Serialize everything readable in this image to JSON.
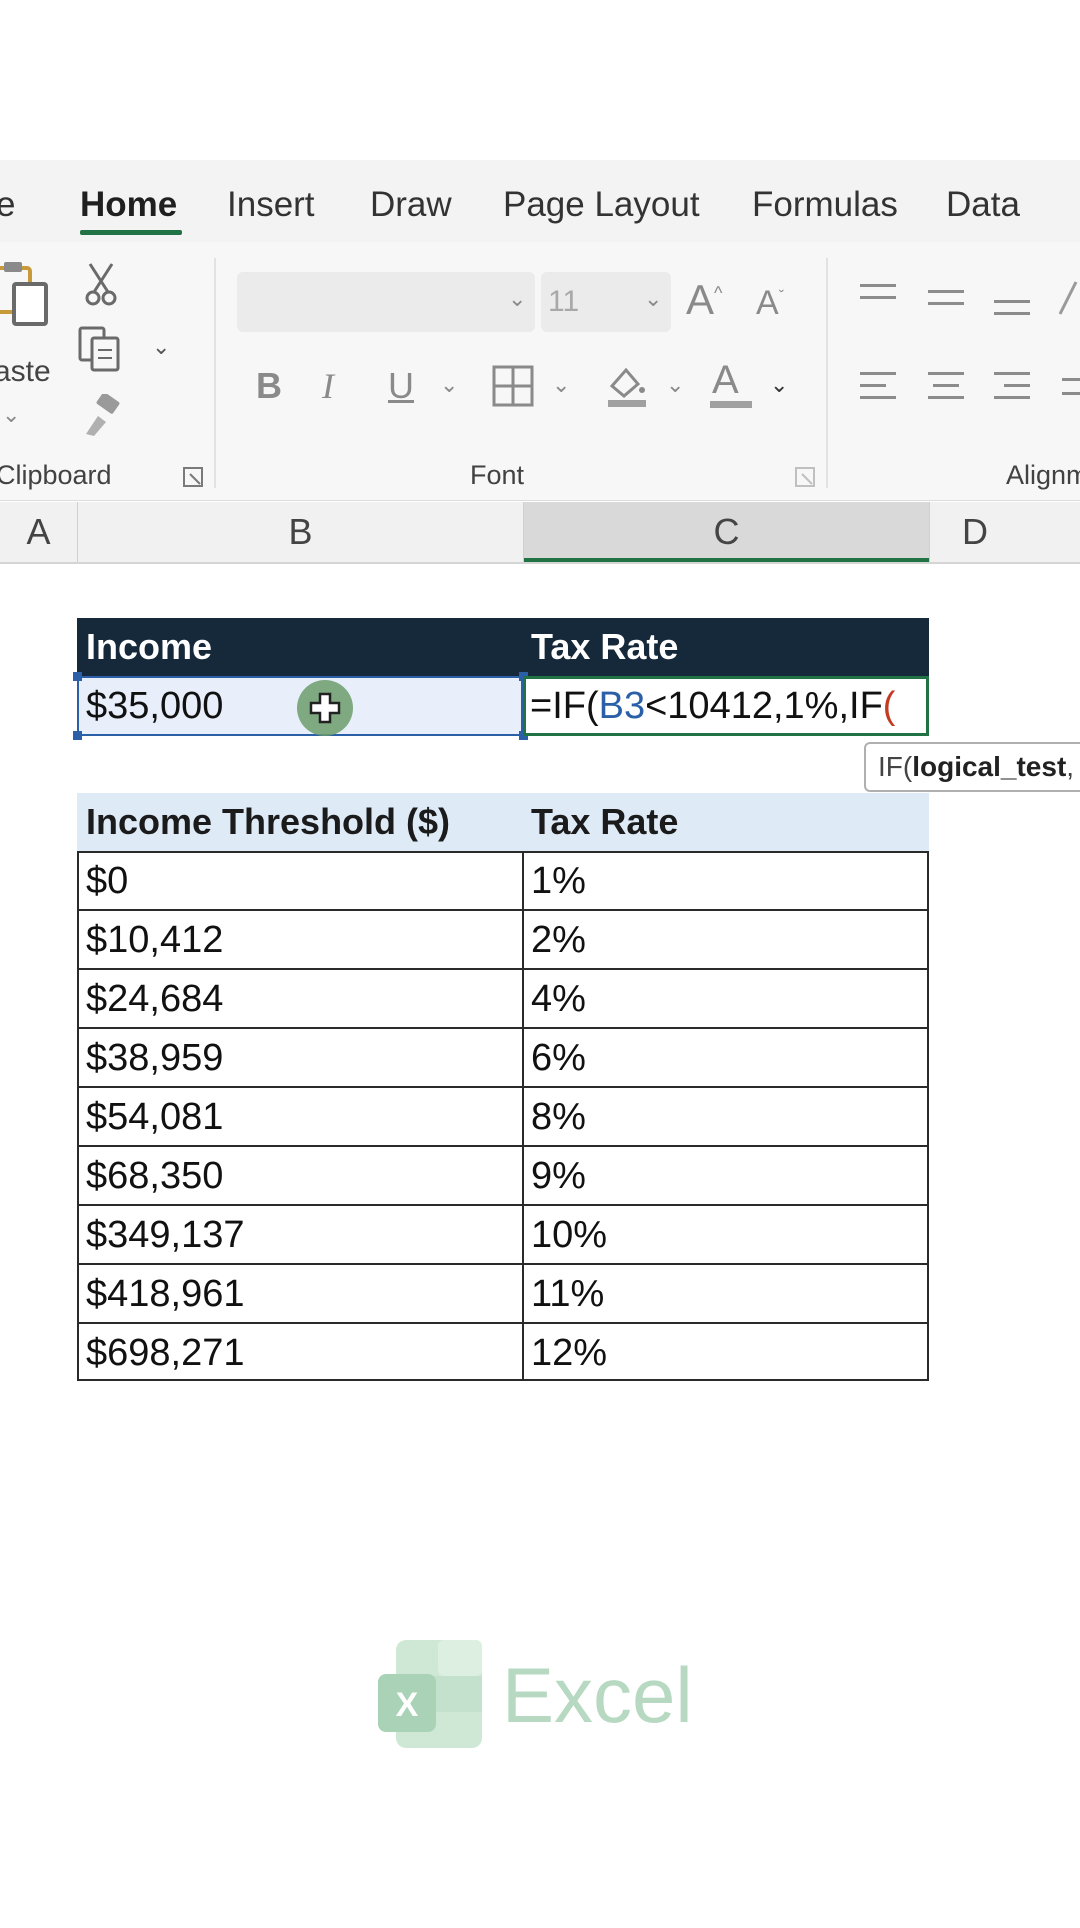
{
  "ribbon": {
    "tabs": [
      {
        "label": "e"
      },
      {
        "label": "Home"
      },
      {
        "label": "Insert"
      },
      {
        "label": "Draw"
      },
      {
        "label": "Page Layout"
      },
      {
        "label": "Formulas"
      },
      {
        "label": "Data"
      }
    ],
    "active_tab": "Home",
    "clipboard": {
      "paste_label": "aste",
      "group_label": "Clipboard"
    },
    "font": {
      "font_size": "11",
      "group_label": "Font",
      "bold": "B",
      "italic": "I",
      "underline": "U",
      "grow": "A",
      "shrink": "A",
      "font_color": "A"
    },
    "alignment": {
      "group_label": "Alignm"
    }
  },
  "columns": {
    "a": "A",
    "b": "B",
    "c": "C",
    "d": "D"
  },
  "lookup_table": {
    "headers": [
      "Income",
      "Tax Rate"
    ],
    "income_value": "$35,000",
    "formula_prefix": "=IF(",
    "formula_ref": "B3",
    "formula_middle": "<10412,1%,IF",
    "formula_paren": "("
  },
  "tooltip": {
    "prefix": "IF(",
    "arg": "logical_test",
    "suffix": ","
  },
  "threshold_table": {
    "headers": [
      "Income Threshold ($)",
      "Tax Rate"
    ],
    "rows": [
      [
        "$0",
        "1%"
      ],
      [
        "$10,412",
        "2%"
      ],
      [
        "$24,684",
        "4%"
      ],
      [
        "$38,959",
        "6%"
      ],
      [
        "$54,081",
        "8%"
      ],
      [
        "$68,350",
        "9%"
      ],
      [
        "$349,137",
        "10%"
      ],
      [
        "$418,961",
        "11%"
      ],
      [
        "$698,271",
        "12%"
      ]
    ]
  },
  "watermark": {
    "logo_letter": "X",
    "text": "Excel"
  },
  "colors": {
    "accent": "#217346",
    "header_dark": "#16293a",
    "header_light": "#deebf7",
    "watermark": "#b7d9c2"
  }
}
